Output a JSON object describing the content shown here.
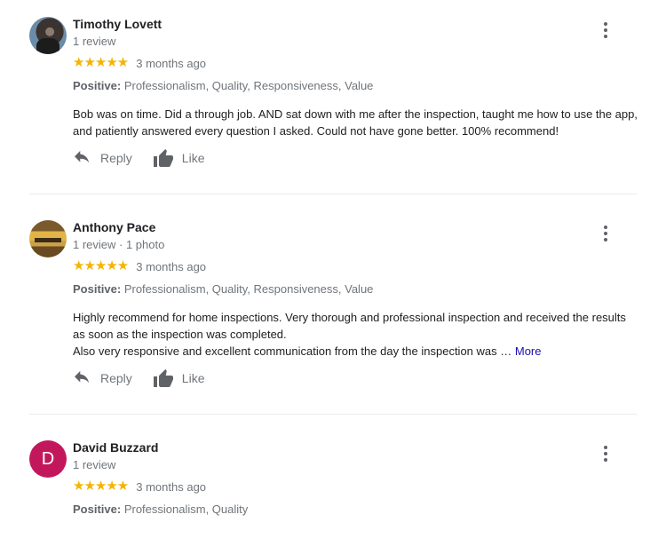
{
  "reviews": [
    {
      "name": "Timothy Lovett",
      "meta": "1 review",
      "stars": "★★★★★",
      "rating": 5,
      "ago": "3 months ago",
      "positive_label": "Positive:",
      "positive_values": "Professionalism, Quality, Responsiveness, Value",
      "body": "Bob was on time. Did a through job. AND sat down with me after the inspection, taught me how to use the app, and patiently answered every question I asked. Could not have gone better. 100% recommend!",
      "reply_label": "Reply",
      "like_label": "Like"
    },
    {
      "name": "Anthony Pace",
      "meta": "1 review · 1 photo",
      "stars": "★★★★★",
      "rating": 5,
      "ago": "3 months ago",
      "positive_label": "Positive:",
      "positive_values": "Professionalism, Quality, Responsiveness, Value",
      "body_line1": "Highly recommend for home inspections. Very thorough and professional inspection and received the results as soon as the inspection was completed.",
      "body_line2": "Also very responsive and excellent communication from the day the inspection was …",
      "more_label": "More",
      "reply_label": "Reply",
      "like_label": "Like"
    },
    {
      "name": "David Buzzard",
      "avatar_letter": "D",
      "avatar_color": "#c2185b",
      "meta": "1 review",
      "stars": "★★★★★",
      "rating": 5,
      "ago": "3 months ago",
      "positive_label": "Positive:",
      "positive_values": "Professionalism, Quality"
    }
  ],
  "colors": {
    "star": "#f4b400",
    "link": "#1a0dab",
    "muted": "#70757a",
    "divider": "#e8eaed"
  }
}
